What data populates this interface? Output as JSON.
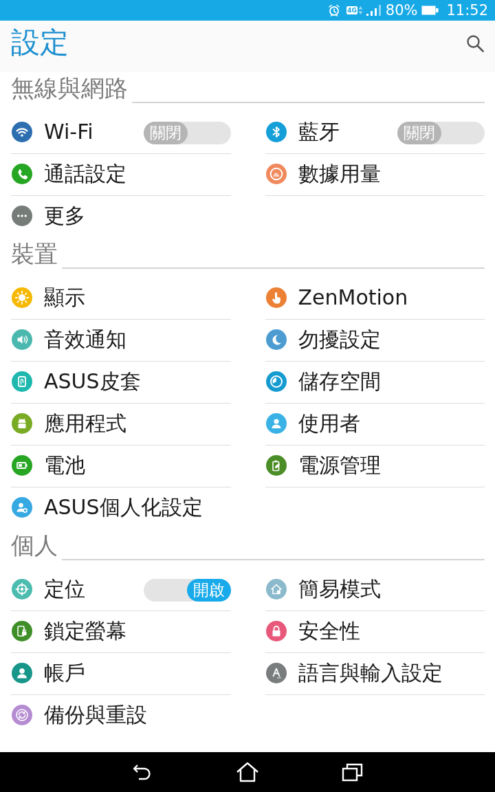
{
  "status_bar": {
    "network": "4G",
    "battery": "80%",
    "time": "11:52"
  },
  "app_bar": {
    "title": "設定"
  },
  "sections": [
    {
      "title": "無線與網路",
      "items": [
        {
          "label": "Wi-Fi",
          "kind": "switch",
          "color": "#2c6eb0",
          "switch": {
            "on": false,
            "label": "關閉"
          }
        },
        {
          "label": "藍牙",
          "kind": "switch",
          "color": "#159fd8",
          "switch": {
            "on": false,
            "label": "關閉"
          }
        },
        {
          "label": "通話設定",
          "kind": "link",
          "color": "#27a623"
        },
        {
          "label": "數據用量",
          "kind": "link",
          "color": "#f0895c"
        },
        {
          "label": "更多",
          "kind": "link",
          "color": "#767d79"
        }
      ]
    },
    {
      "title": "裝置",
      "items": [
        {
          "label": "顯示",
          "kind": "link",
          "color": "#f6b800"
        },
        {
          "label": "ZenMotion",
          "kind": "link",
          "color": "#ec8136"
        },
        {
          "label": "音效通知",
          "kind": "link",
          "color": "#4ab8ae"
        },
        {
          "label": "勿擾設定",
          "kind": "link",
          "color": "#4c9cd2"
        },
        {
          "label": "ASUS皮套",
          "kind": "link",
          "color": "#1eb8ae"
        },
        {
          "label": "儲存空間",
          "kind": "link",
          "color": "#159bd0"
        },
        {
          "label": "應用程式",
          "kind": "link",
          "color": "#7aab25"
        },
        {
          "label": "使用者",
          "kind": "link",
          "color": "#3ab2e5"
        },
        {
          "label": "電池",
          "kind": "link",
          "color": "#27a623"
        },
        {
          "label": "電源管理",
          "kind": "link",
          "color": "#4b8d26"
        },
        {
          "label": "ASUS個人化設定",
          "kind": "link",
          "color": "#37a9e2"
        }
      ]
    },
    {
      "title": "個人",
      "items": [
        {
          "label": "定位",
          "kind": "switch",
          "color": "#4cbcae",
          "switch": {
            "on": true,
            "label": "開啟"
          }
        },
        {
          "label": "簡易模式",
          "kind": "link",
          "color": "#8cbacd"
        },
        {
          "label": "鎖定螢幕",
          "kind": "link",
          "color": "#3f8f29"
        },
        {
          "label": "安全性",
          "kind": "link",
          "color": "#e8587a"
        },
        {
          "label": "帳戶",
          "kind": "link",
          "color": "#18968a"
        },
        {
          "label": "語言與輸入設定",
          "kind": "link",
          "color": "#7a7d7d"
        },
        {
          "label": "備份與重設",
          "kind": "link",
          "color": "#b58bd2"
        }
      ]
    }
  ]
}
